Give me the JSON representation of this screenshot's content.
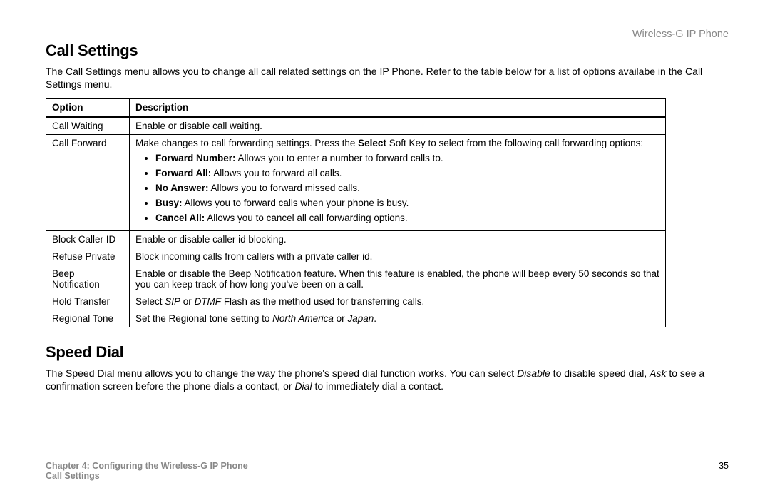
{
  "product": "Wireless-G IP Phone",
  "section1": {
    "title": "Call Settings",
    "intro": "The Call Settings menu allows you to change all call related settings on the IP Phone. Refer to the table below for a list of options availabe in the Call Settings menu."
  },
  "table": {
    "head_option": "Option",
    "head_desc": "Description",
    "r0_opt": "Call Waiting",
    "r0_desc": "Enable or disable call waiting.",
    "r1_opt": "Call Forward",
    "r1_pre": "Make changes to call forwarding settings. Press the ",
    "r1_bold": "Select",
    "r1_post": " Soft Key to select from the following call forwarding options:",
    "r1_b1_t": "Forward Number:",
    "r1_b1_d": " Allows you to enter a number to forward calls to.",
    "r1_b2_t": "Forward All:",
    "r1_b2_d": " Allows you to forward all calls.",
    "r1_b3_t": "No Answer:",
    "r1_b3_d": " Allows you to forward missed calls.",
    "r1_b4_t": "Busy:",
    "r1_b4_d": " Allows you to forward calls when your phone is busy.",
    "r1_b5_t": "Cancel All:",
    "r1_b5_d": " Allows you to cancel all call forwarding options.",
    "r2_opt": "Block Caller ID",
    "r2_desc": "Enable or disable caller id blocking.",
    "r3_opt": "Refuse Private",
    "r3_desc": "Block incoming calls from callers with a private caller id.",
    "r4_opt": "Beep Notification",
    "r4_desc": "Enable or disable the Beep Notification feature. When this feature is enabled, the phone will beep every 50 seconds so that you can keep track of how long you've been on a call.",
    "r5_opt": "Hold Transfer",
    "r5_pre": "Select ",
    "r5_i1": "SIP",
    "r5_mid": " or ",
    "r5_i2": "DTMF",
    "r5_post": " Flash as the method used for transferring calls.",
    "r6_opt": "Regional Tone",
    "r6_pre": "Set the Regional tone setting to ",
    "r6_i1": "North America",
    "r6_mid": " or ",
    "r6_i2": "Japan",
    "r6_post": "."
  },
  "section2": {
    "title": "Speed Dial",
    "p_pre": "The Speed Dial menu allows you to change the way the phone's speed dial function works. You can select ",
    "p_i1": "Disable",
    "p_mid1": " to disable speed dial, ",
    "p_i2": "Ask",
    "p_mid2": " to see a confirmation screen before the phone dials a contact, or ",
    "p_i3": "Dial",
    "p_post": " to immediately dial a contact."
  },
  "footer": {
    "chapter": "Chapter 4: Configuring the Wireless-G IP Phone",
    "page": "35",
    "crumb": "Call Settings"
  }
}
